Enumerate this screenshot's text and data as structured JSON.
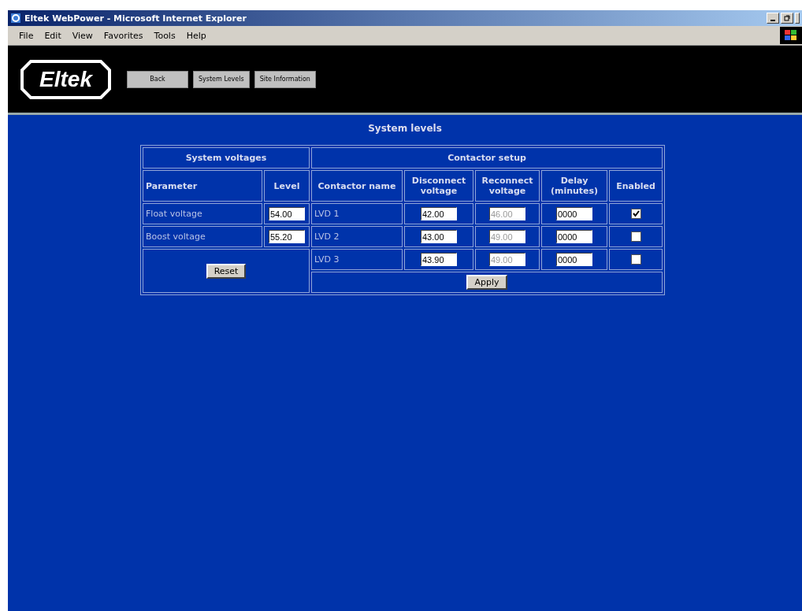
{
  "window": {
    "title": "Eltek WebPower - Microsoft Internet Explorer"
  },
  "menu": [
    "File",
    "Edit",
    "View",
    "Favorites",
    "Tools",
    "Help"
  ],
  "header": {
    "logo": "Eltek",
    "buttons": [
      "Back",
      "System Levels",
      "Site Information"
    ]
  },
  "page_title": "System levels",
  "system_voltages": {
    "title": "System voltages",
    "columns": [
      "Parameter",
      "Level"
    ],
    "rows": [
      {
        "parameter": "Float voltage",
        "level": "54.00"
      },
      {
        "parameter": "Boost voltage",
        "level": "55.20"
      }
    ],
    "reset": "Reset"
  },
  "contactor_setup": {
    "title": "Contactor setup",
    "columns": [
      "Contactor name",
      "Disconnect voltage",
      "Reconnect voltage",
      "Delay (minutes)",
      "Enabled"
    ],
    "rows": [
      {
        "name": "LVD 1",
        "disconnect": "42.00",
        "reconnect": "46.00",
        "reconnect_disabled": true,
        "delay": "0000",
        "enabled": true
      },
      {
        "name": "LVD 2",
        "disconnect": "43.00",
        "reconnect": "49.00",
        "reconnect_disabled": true,
        "delay": "0000",
        "enabled": false
      },
      {
        "name": "LVD 3",
        "disconnect": "43.90",
        "reconnect": "49.00",
        "reconnect_disabled": true,
        "delay": "0000",
        "enabled": false
      }
    ],
    "apply": "Apply"
  }
}
